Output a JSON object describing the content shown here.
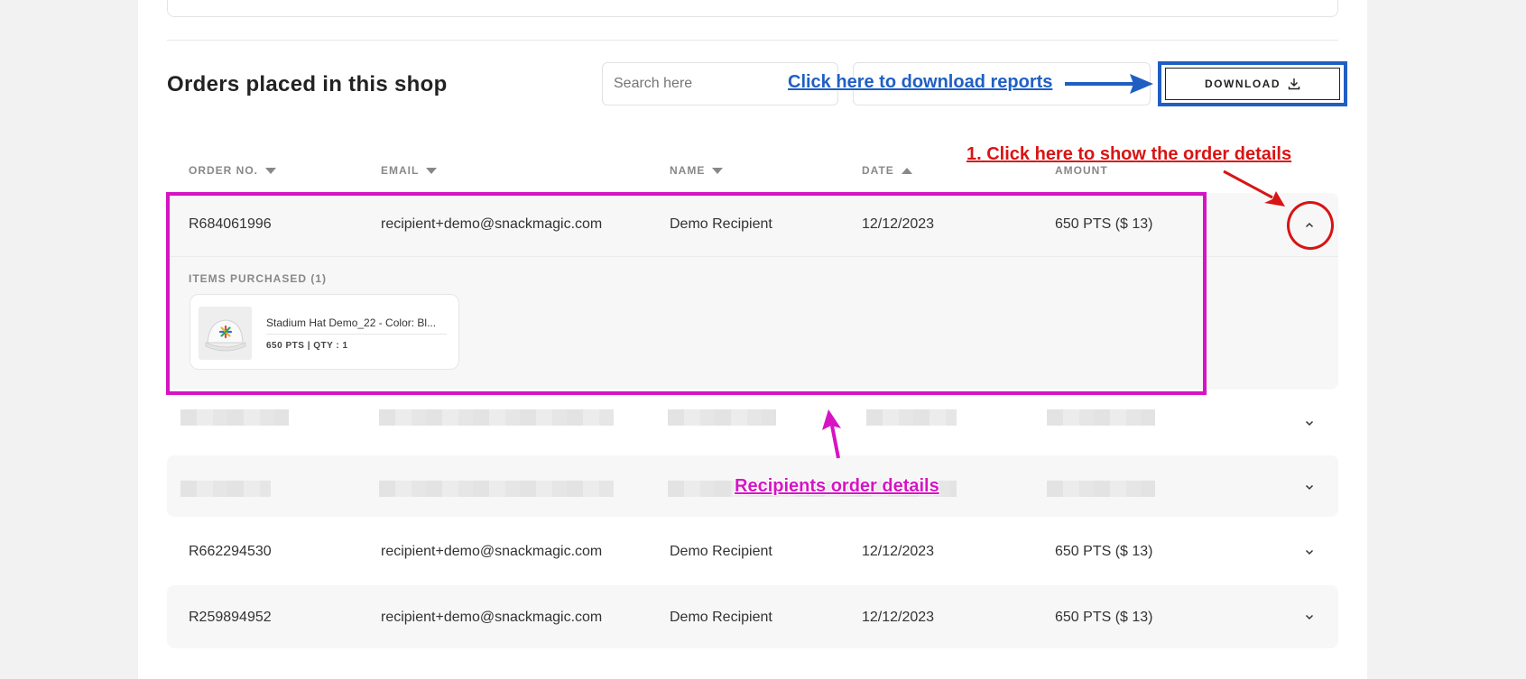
{
  "page": {
    "title": "Orders placed in this shop",
    "search_placeholder": "Search here",
    "download_label": "DOWNLOAD"
  },
  "table": {
    "headers": [
      {
        "label": "ORDER NO.",
        "sort": "down"
      },
      {
        "label": "EMAIL",
        "sort": "down"
      },
      {
        "label": "NAME",
        "sort": "down"
      },
      {
        "label": "DATE",
        "sort": "up"
      },
      {
        "label": "AMOUNT",
        "sort": null
      }
    ],
    "expanded_row": {
      "order_no": "R684061996",
      "email": "recipient+demo@snackmagic.com",
      "name": "Demo Recipient",
      "date": "12/12/2023",
      "amount": "650 PTS ($ 13)",
      "items_label": "ITEMS PURCHASED (1)",
      "item": {
        "name": "Stadium Hat Demo_22 - Color: Bl...",
        "meta": "650 PTS | QTY : 1"
      }
    },
    "rows": [
      {
        "order_no": "R662294530",
        "email": "recipient+demo@snackmagic.com",
        "name": "Demo Recipient",
        "date": "12/12/2023",
        "amount": "650 PTS ($ 13)"
      },
      {
        "order_no": "R259894952",
        "email": "recipient+demo@snackmagic.com",
        "name": "Demo Recipient",
        "date": "12/12/2023",
        "amount": "650 PTS ($ 13)"
      }
    ]
  },
  "annotations": {
    "download": "Click here to download reports",
    "expand": "1. Click here to show the order details",
    "details": "Recipients order details",
    "colors": {
      "blue": "#1f5fc4",
      "red": "#d81414",
      "magenta": "#d614c4"
    }
  },
  "icons": {
    "download": "download-icon",
    "expand_open": "chevron-up-icon",
    "expand_closed": "chevron-down-icon",
    "sort_desc": "caret-down-icon",
    "sort_asc": "caret-up-icon",
    "product": "cap-thumbnail"
  }
}
